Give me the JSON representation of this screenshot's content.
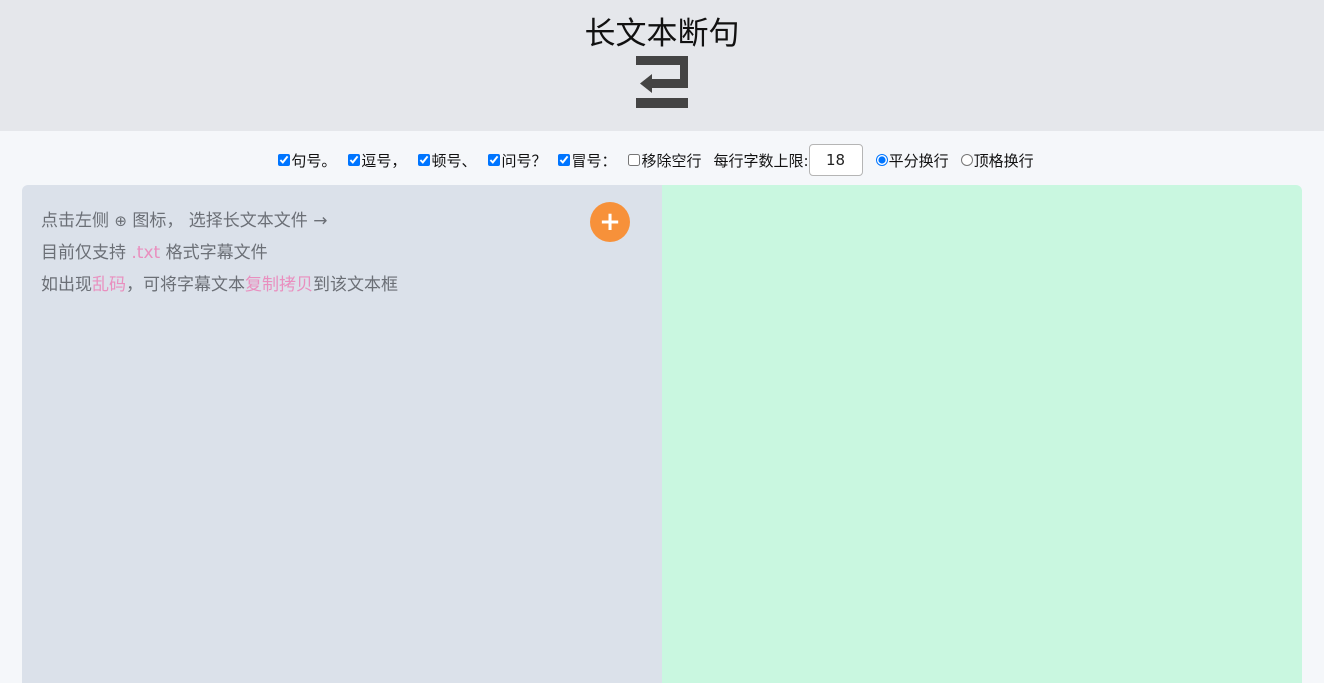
{
  "header": {
    "title": "长文本断句",
    "icon": "wrap-text-icon"
  },
  "options": {
    "checkboxes": [
      {
        "label": "句号。",
        "checked": true
      },
      {
        "label": "逗号，",
        "checked": true
      },
      {
        "label": "顿号、",
        "checked": true
      },
      {
        "label": "问号？",
        "checked": true
      },
      {
        "label": "冒号：",
        "checked": true
      },
      {
        "label": "移除空行",
        "checked": false
      }
    ],
    "limit_label": "每行字数上限:",
    "limit_value": "18",
    "radios": [
      {
        "label": "平分换行",
        "checked": true
      },
      {
        "label": "顶格换行",
        "checked": false
      }
    ]
  },
  "left": {
    "line1_a": "点击左侧",
    "line1_icon": "⊕",
    "line1_b": "图标， 选择长文本文件",
    "line1_arrow": "→",
    "line2_a": "目前仅支持",
    "line2_ext": ".txt",
    "line2_b": "格式字幕文件",
    "line3_a": "如出现",
    "line3_garbled": "乱码",
    "line3_b": "，可将字幕文本",
    "line3_copy": "复制拷贝",
    "line3_c": "到该文本框",
    "add_button": "+"
  },
  "colors": {
    "header_bg": "#e5e7eb",
    "left_bg": "#dbe1ea",
    "right_bg": "#c9f7e0",
    "accent": "#f7913a",
    "highlight": "#e98fbf"
  }
}
